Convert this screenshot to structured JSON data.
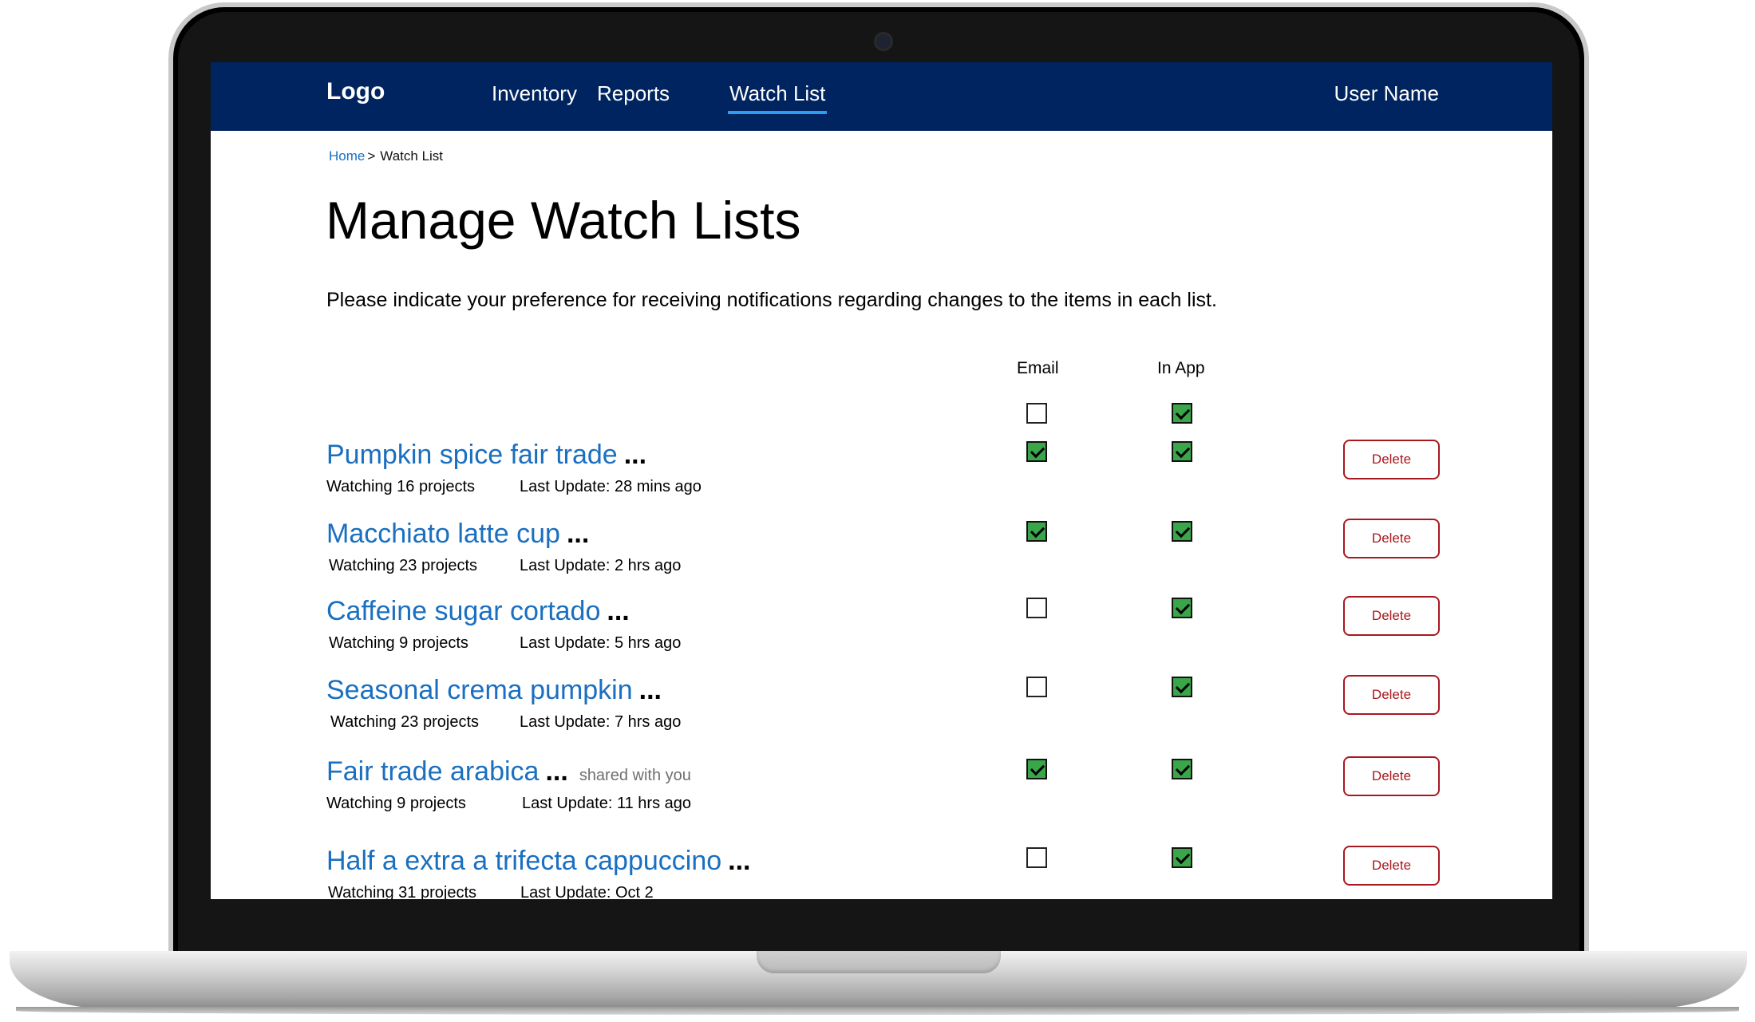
{
  "nav": {
    "logo": "Logo",
    "items": [
      {
        "label": "Inventory",
        "active": false
      },
      {
        "label": "Reports",
        "active": false
      },
      {
        "label": "Watch List",
        "active": true
      }
    ],
    "user_name": "User Name"
  },
  "breadcrumb": {
    "home": "Home",
    "separator": ">",
    "current": "Watch List"
  },
  "page": {
    "title": "Manage Watch Lists",
    "intro": "Please indicate your preference for receiving notifications regarding changes to the items in each list."
  },
  "table": {
    "columns": {
      "email": "Email",
      "in_app": "In App"
    },
    "select_all": {
      "email": false,
      "in_app": true
    },
    "delete_label": "Delete",
    "ellipsis": "...",
    "rows": [
      {
        "title": "Pumpkin spice fair trade",
        "shared": "",
        "watching": "Watching 16 projects",
        "last_update": "Last Update: 28 mins ago",
        "email": true,
        "in_app": true
      },
      {
        "title": "Macchiato latte cup",
        "shared": "",
        "watching": "Watching 23 projects",
        "last_update": "Last Update: 2 hrs ago",
        "email": true,
        "in_app": true
      },
      {
        "title": "Caffeine sugar cortado",
        "shared": "",
        "watching": "Watching 9 projects",
        "last_update": "Last Update: 5 hrs ago",
        "email": false,
        "in_app": true
      },
      {
        "title": "Seasonal crema pumpkin",
        "shared": "",
        "watching": "Watching 23 projects",
        "last_update": "Last Update: 7 hrs ago",
        "email": false,
        "in_app": true
      },
      {
        "title": "Fair trade arabica",
        "shared": "shared with you",
        "watching": "Watching 9 projects",
        "last_update": "Last Update: 11 hrs ago",
        "email": true,
        "in_app": true
      },
      {
        "title": "Half a extra a trifecta cappuccino",
        "shared": "",
        "watching": "Watching 31 projects",
        "last_update": "Last Update: Oct 2",
        "email": false,
        "in_app": true
      }
    ]
  },
  "colors": {
    "nav_background": "#00245f",
    "link": "#1a6fc0",
    "checkbox_checked": "#3aa64a",
    "delete": "#a8181f",
    "nav_active_underline": "#2e9cf0"
  }
}
